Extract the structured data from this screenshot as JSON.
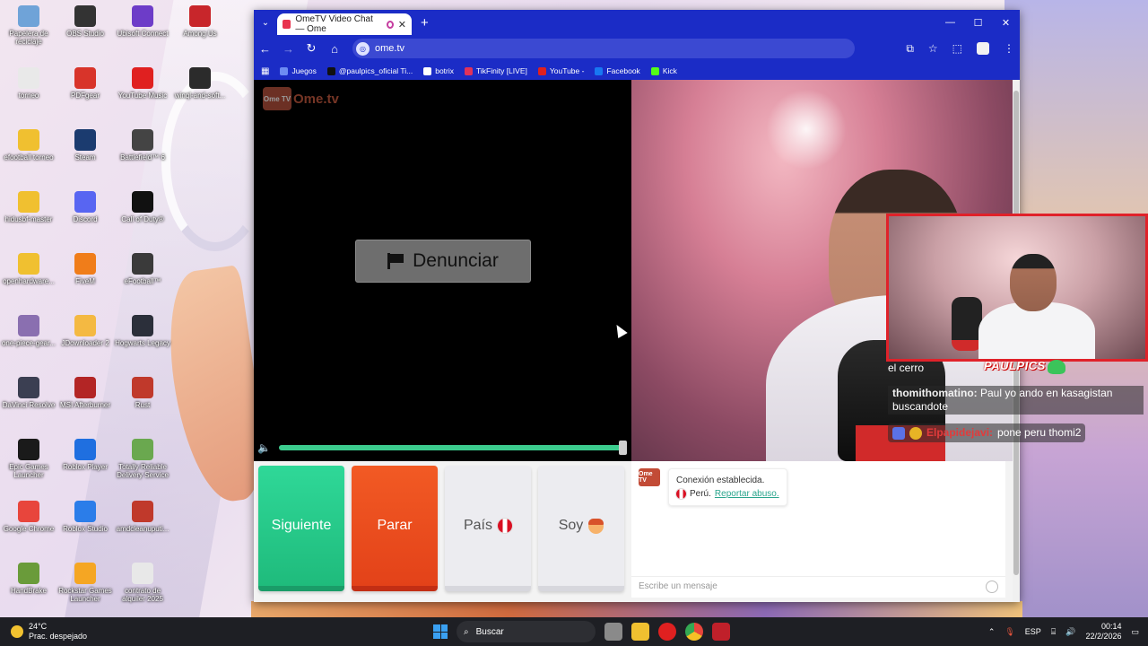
{
  "desktop": {
    "icons": [
      {
        "label": "Papelera de reciclaje",
        "color": "#6fa3d8"
      },
      {
        "label": "OBS Studio",
        "color": "#333333"
      },
      {
        "label": "Ubisoft Connect",
        "color": "#6d3cc8"
      },
      {
        "label": "Among Us",
        "color": "#c8262b"
      },
      {
        "label": "torneo",
        "color": "#e9e9e9"
      },
      {
        "label": "PDFgear",
        "color": "#d8342a"
      },
      {
        "label": "YouTube Music",
        "color": "#e02020"
      },
      {
        "label": "winql-and-soft...",
        "color": "#2b2b2b"
      },
      {
        "label": "efootball torneo",
        "color": "#f0c030"
      },
      {
        "label": "Steam",
        "color": "#1b3b6f"
      },
      {
        "label": "Battlefield™ 6",
        "color": "#444444"
      },
      {
        "label": "hidusbf-master",
        "color": "#f0c030"
      },
      {
        "label": "Discord",
        "color": "#5865f2"
      },
      {
        "label": "Call of Duty®",
        "color": "#111111"
      },
      {
        "label": "openhardware...",
        "color": "#f0c030"
      },
      {
        "label": "FiveM",
        "color": "#f07d1a"
      },
      {
        "label": "eFootball™",
        "color": "#3a3a3a"
      },
      {
        "label": "one-piece-gear...",
        "color": "#8a6fb0"
      },
      {
        "label": "JDownloader 2",
        "color": "#f4b942"
      },
      {
        "label": "Hogwarts Legacy",
        "color": "#2b2f3a"
      },
      {
        "label": "DaVinci Resolve",
        "color": "#3b3f52"
      },
      {
        "label": "MSI Afterburner",
        "color": "#b32525"
      },
      {
        "label": "Rust",
        "color": "#c0392b"
      },
      {
        "label": "Epic Games Launcher",
        "color": "#1a1a1a"
      },
      {
        "label": "Roblox Player",
        "color": "#1f6fe0"
      },
      {
        "label": "Totally Reliable Delivery Service",
        "color": "#6aa84f"
      },
      {
        "label": "Google Chrome",
        "color": "#e8453c"
      },
      {
        "label": "Roblox Studio",
        "color": "#2b7de9"
      },
      {
        "label": "amdcleanuputi...",
        "color": "#c0392b"
      },
      {
        "label": "HandBrake",
        "color": "#6a9b3a"
      },
      {
        "label": "Rockstar Games Launcher",
        "color": "#f5a623"
      },
      {
        "label": "contrato de alquiler 2025",
        "color": "#e8e8e8"
      }
    ]
  },
  "browser": {
    "tab_title": "OmeTV Video Chat — Ome",
    "new_tab_icon": "plus-icon",
    "window_controls": {
      "minimize": "—",
      "maximize": "☐",
      "close": "✕"
    },
    "url": "ome.tv",
    "bookmarks": [
      {
        "label": "Juegos",
        "color": "#6d8cf2"
      },
      {
        "label": "@paulpics_oficial Ti...",
        "color": "#111111"
      },
      {
        "label": "botrix",
        "color": "#ffffff"
      },
      {
        "label": "TikFinity [LIVE]",
        "color": "#e0325a"
      },
      {
        "label": "YouTube -",
        "color": "#e02020"
      },
      {
        "label": "Facebook",
        "color": "#1877f2"
      },
      {
        "label": "Kick",
        "color": "#53fc18"
      }
    ]
  },
  "ometv": {
    "logo_text": "Ome.tv",
    "logo_mark": "Ome TV",
    "report_button": "Denunciar",
    "volume_level": 0.99,
    "buttons": {
      "next": "Siguiente",
      "stop": "Parar",
      "country": "País",
      "gender": "Soy"
    },
    "system_message": {
      "line1": "Conexión establecida.",
      "country": "Perú.",
      "report_link": "Reportar abuso."
    },
    "message_placeholder": "Escribe un mensaje"
  },
  "overlay": {
    "brand": "PAULPICS",
    "chat": [
      {
        "user": "",
        "text": "el cerro"
      },
      {
        "user": "thomithomatino:",
        "text": "Paul yo ando en kasagistan buscandote"
      },
      {
        "user": "Elpapidejavi:",
        "text": "pone peru thomi2"
      }
    ]
  },
  "taskbar": {
    "temperature": "24°C",
    "weather": "Prac. despejado",
    "search_label": "Buscar",
    "language": "ESP",
    "time": "00:14",
    "date": "22/2/2026"
  }
}
